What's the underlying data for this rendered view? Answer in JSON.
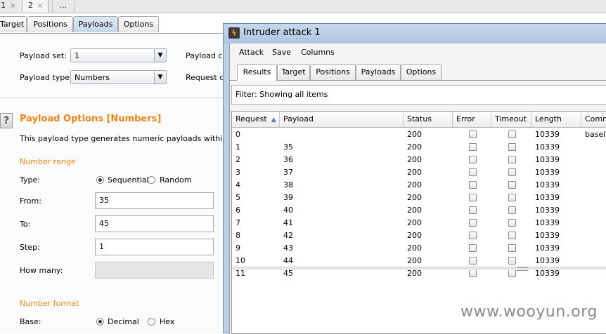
{
  "top_tabs": [
    {
      "label": "1",
      "close": "×"
    },
    {
      "label": "2",
      "close": "×"
    },
    {
      "label": "..."
    }
  ],
  "config_tabs": [
    "Target",
    "Positions",
    "Payloads",
    "Options"
  ],
  "payload_sets": {
    "set_label": "Payload set:",
    "set_value": "1",
    "type_label": "Payload type:",
    "type_value": "Numbers",
    "count_label_partial": "Payload co",
    "request_label_partial": "Request co"
  },
  "payload_options": {
    "title": "Payload Options [Numbers]",
    "description": "This payload type generates numeric payloads within a give",
    "number_range_title": "Number range",
    "type_label": "Type:",
    "sequential": "Sequential",
    "random": "Random",
    "from_label": "From:",
    "from_value": "35",
    "to_label": "To:",
    "to_value": "45",
    "step_label": "Step:",
    "step_value": "1",
    "howmany_label": "How many:",
    "number_format_title": "Number format",
    "base_label": "Base:",
    "decimal": "Decimal",
    "hex": "Hex"
  },
  "attack_window": {
    "title": "Intruder attack 1",
    "menu": [
      "Attack",
      "Save",
      "Columns"
    ],
    "tabs": [
      "Results",
      "Target",
      "Positions",
      "Payloads",
      "Options"
    ],
    "filter_text": "Filter:  Showing all items",
    "columns": [
      "Request",
      "Payload",
      "Status",
      "Error",
      "Timeout",
      "Length",
      "Comme"
    ],
    "rows": [
      {
        "request": "0",
        "payload": "",
        "status": "200",
        "length": "10339",
        "comment": "baselin"
      },
      {
        "request": "1",
        "payload": "35",
        "status": "200",
        "length": "10339",
        "comment": ""
      },
      {
        "request": "2",
        "payload": "36",
        "status": "200",
        "length": "10339",
        "comment": ""
      },
      {
        "request": "3",
        "payload": "37",
        "status": "200",
        "length": "10339",
        "comment": ""
      },
      {
        "request": "4",
        "payload": "38",
        "status": "200",
        "length": "10339",
        "comment": ""
      },
      {
        "request": "5",
        "payload": "39",
        "status": "200",
        "length": "10339",
        "comment": ""
      },
      {
        "request": "6",
        "payload": "40",
        "status": "200",
        "length": "10339",
        "comment": ""
      },
      {
        "request": "7",
        "payload": "41",
        "status": "200",
        "length": "10339",
        "comment": ""
      },
      {
        "request": "8",
        "payload": "42",
        "status": "200",
        "length": "10339",
        "comment": ""
      },
      {
        "request": "9",
        "payload": "43",
        "status": "200",
        "length": "10339",
        "comment": ""
      },
      {
        "request": "10",
        "payload": "44",
        "status": "200",
        "length": "10339",
        "comment": ""
      },
      {
        "request": "11",
        "payload": "45",
        "status": "200",
        "length": "10339",
        "comment": ""
      }
    ]
  },
  "watermark": "www.wooyun.org",
  "colors": {
    "section_orange": "#e8861a",
    "titlebar_blue": "#aec6e2",
    "active_tab_blue": "#c6d7ec"
  }
}
